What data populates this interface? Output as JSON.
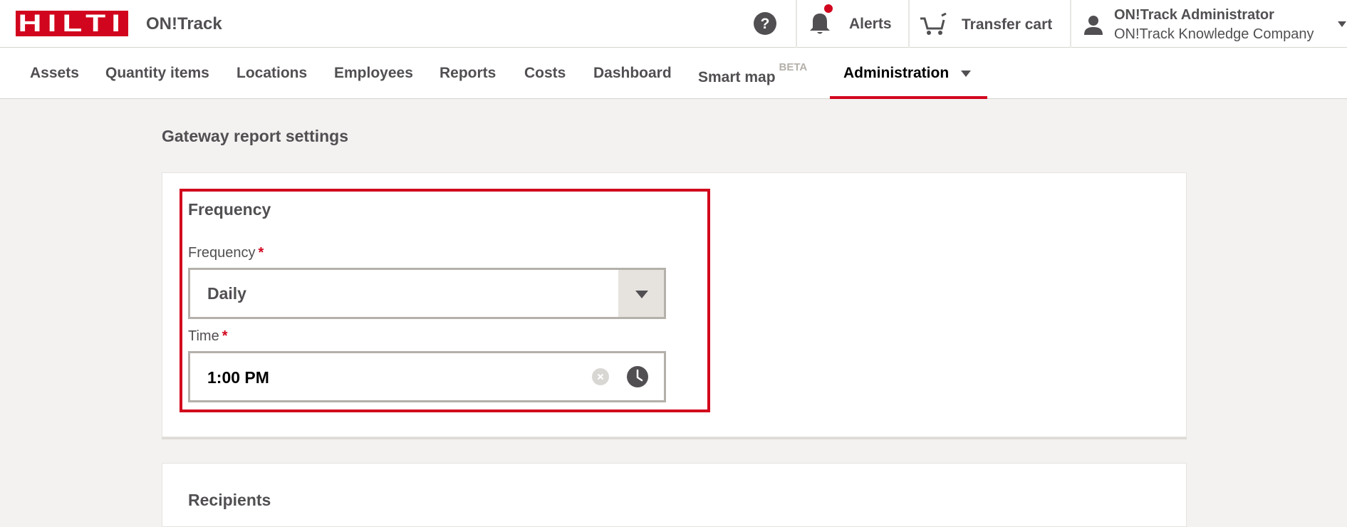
{
  "header": {
    "logo_text": "HILTI",
    "app_name": "ON!Track",
    "alerts_label": "Alerts",
    "cart_label": "Transfer cart",
    "user_name": "ON!Track Administrator",
    "user_company": "ON!Track Knowledge Company"
  },
  "nav": {
    "items": [
      {
        "label": "Assets"
      },
      {
        "label": "Quantity items"
      },
      {
        "label": "Locations"
      },
      {
        "label": "Employees"
      },
      {
        "label": "Reports"
      },
      {
        "label": "Costs"
      },
      {
        "label": "Dashboard"
      },
      {
        "label": "Smart map",
        "badge": "BETA"
      },
      {
        "label": "Administration",
        "active": true
      }
    ]
  },
  "page": {
    "title": "Gateway report settings",
    "frequency_section": {
      "title": "Frequency",
      "frequency_label": "Frequency",
      "frequency_value": "Daily",
      "time_label": "Time",
      "time_value": "1:00 PM",
      "required_mark": "*"
    },
    "recipients_section": {
      "title": "Recipients"
    }
  },
  "colors": {
    "brand_red": "#d2051e",
    "text": "#524f53",
    "background": "#f3f2f0"
  }
}
